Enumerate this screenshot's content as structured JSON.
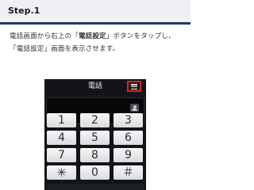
{
  "step": {
    "title": "Step.1"
  },
  "instruction": {
    "before": "電話画面から右上の「",
    "highlight": "電話設定",
    "after": "」ボタンをタップし、「電話設定」画面を表示させます。"
  },
  "phone": {
    "title": "電話",
    "settings_icon": "menu-icon",
    "contact_icon": "contact-icon",
    "highlight_color": "#e0211a",
    "keys": [
      "1",
      "2",
      "3",
      "4",
      "5",
      "6",
      "7",
      "8",
      "9",
      "✳",
      "0",
      "＃"
    ]
  },
  "colors": {
    "header_accent": "#1f3a6e",
    "screen_bg": "#121418"
  }
}
